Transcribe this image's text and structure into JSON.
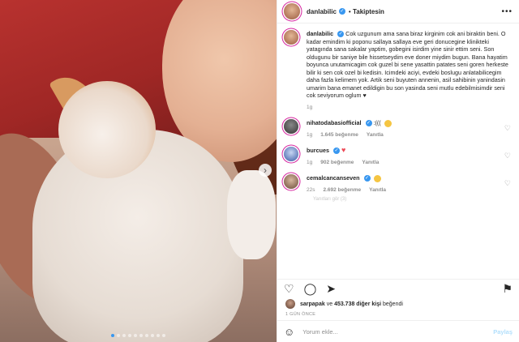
{
  "header": {
    "username": "danlabilic",
    "verified_mark": "✓",
    "separator": "•",
    "follow_label": "Takiptesin",
    "more_label": "•••"
  },
  "caption": {
    "username": "danlabilic",
    "text": "Cok uzgunum ama sana biraz kirginim cok ani biraktin beni. O kadar emindim ki poponu sallaya sallaya eve geri donucegine klinikteki yatagında sana sakalar yaptim, gobegini isirdim yine sinir ettim seni. Son oldugunu bir saniye bile hissetseydim eve doner miydim bugun. Bana hayatim boyunca unutamicagim cok guzel bi sene yasattin patates seni goren herkeste bilir ki sen cok ozel bi kedisin. Icimdeki aciyi, evdeki boslugu anlatabilicegim daha fazla kelimem yok. Artik seni buyuten annenin, asil sahibinin yanindasin umarim bana emanet edildigin bu son yasinda seni mutlu edebilmisimdir seni cok seviyorum oglum ♥",
    "time": "1g"
  },
  "comments": [
    {
      "username": "nihatodabasiofficial",
      "text": ":(((",
      "time": "1g",
      "likes": "1.645 beğenme",
      "reply": "Yanıtla"
    },
    {
      "username": "burcues",
      "text": "",
      "time": "1g",
      "likes": "902 beğenme",
      "reply": "Yanıtla"
    },
    {
      "username": "cemalcancanseven",
      "text": "",
      "time": "22s",
      "likes": "2.692 beğenme",
      "reply": "Yanıtla"
    }
  ],
  "faded_text": "Yanıtları gör (3)",
  "likes": {
    "first_user": "sarpapak",
    "connector": "ve",
    "count": "453.738 diğer kişi",
    "suffix": "beğendi"
  },
  "timestamp": "1 GÜN ÖNCE",
  "add_comment": {
    "placeholder": "Yorum ekle...",
    "share_label": "Paylaş"
  },
  "icons": {
    "next": "›",
    "heart_outline": "♡",
    "heart_red": "♥",
    "comment": "◯",
    "send": "➤",
    "save": "⚑",
    "smile": "☺"
  },
  "colors": {
    "accent": "#3897f0",
    "red_heart": "#ed4956",
    "muted": "#8e8e8e"
  },
  "carousel": {
    "total_slides": 10,
    "active_slide": 1
  }
}
